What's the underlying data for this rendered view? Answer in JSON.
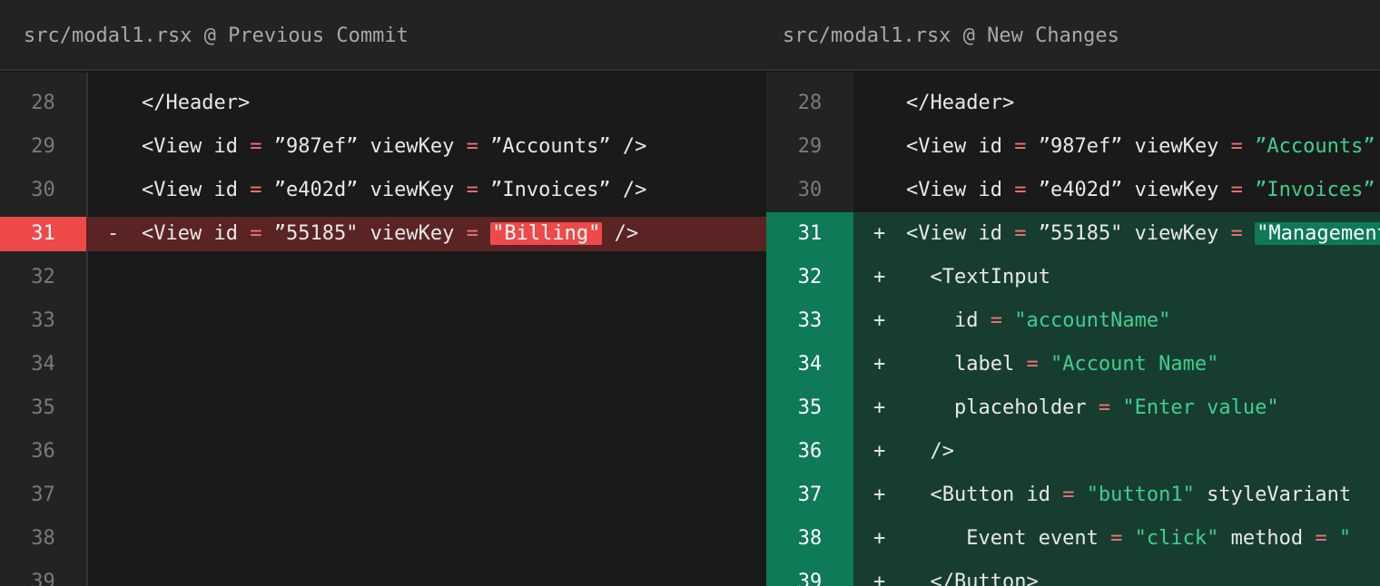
{
  "left": {
    "title": "src/modal1.rsx @ Previous Commit",
    "rows": [
      {
        "n": "28",
        "m": "",
        "kind": "ctx",
        "parts": [
          [
            "t",
            "</Header>"
          ]
        ]
      },
      {
        "n": "29",
        "m": "",
        "kind": "ctx",
        "parts": [
          [
            "t",
            "<View id "
          ],
          [
            "o",
            "="
          ],
          [
            "t",
            " ”987ef” viewKey "
          ],
          [
            "o",
            "="
          ],
          [
            "t",
            " ”Accounts” />"
          ]
        ]
      },
      {
        "n": "30",
        "m": "",
        "kind": "ctx",
        "parts": [
          [
            "t",
            "<View id "
          ],
          [
            "o",
            "="
          ],
          [
            "t",
            " ”e402d” viewKey "
          ],
          [
            "o",
            "="
          ],
          [
            "t",
            " ”Invoices” />"
          ]
        ]
      },
      {
        "n": "31",
        "m": "-",
        "kind": "removed",
        "parts": [
          [
            "t",
            "<View id "
          ],
          [
            "o",
            "="
          ],
          [
            "t",
            " ”55185\" viewKey "
          ],
          [
            "o",
            "="
          ],
          [
            "t",
            " "
          ],
          [
            "hd",
            "\"Billing\""
          ],
          [
            "t",
            " />"
          ]
        ]
      },
      {
        "n": "32",
        "m": "",
        "kind": "empty",
        "parts": []
      },
      {
        "n": "33",
        "m": "",
        "kind": "empty",
        "parts": []
      },
      {
        "n": "34",
        "m": "",
        "kind": "empty",
        "parts": []
      },
      {
        "n": "35",
        "m": "",
        "kind": "empty",
        "parts": []
      },
      {
        "n": "36",
        "m": "",
        "kind": "empty",
        "parts": []
      },
      {
        "n": "37",
        "m": "",
        "kind": "empty",
        "parts": []
      },
      {
        "n": "38",
        "m": "",
        "kind": "empty",
        "parts": []
      },
      {
        "n": "39",
        "m": "",
        "kind": "empty",
        "parts": []
      }
    ]
  },
  "right": {
    "title": "src/modal1.rsx @ New Changes",
    "rows": [
      {
        "n": "28",
        "m": "",
        "kind": "ctx",
        "parts": [
          [
            "t",
            "</Header>"
          ]
        ]
      },
      {
        "n": "29",
        "m": "",
        "kind": "ctx",
        "parts": [
          [
            "t",
            "<View id "
          ],
          [
            "o",
            "="
          ],
          [
            "t",
            " ”987ef” viewKey "
          ],
          [
            "o",
            "="
          ],
          [
            "t",
            " "
          ],
          [
            "s",
            "”Accounts” />"
          ]
        ]
      },
      {
        "n": "30",
        "m": "",
        "kind": "ctx",
        "parts": [
          [
            "t",
            "<View id "
          ],
          [
            "o",
            "="
          ],
          [
            "t",
            " ”e402d” viewKey "
          ],
          [
            "o",
            "="
          ],
          [
            "t",
            " "
          ],
          [
            "s",
            "”Invoices” />"
          ]
        ]
      },
      {
        "n": "31",
        "m": "+",
        "kind": "added",
        "parts": [
          [
            "t",
            "<View id "
          ],
          [
            "o",
            "="
          ],
          [
            "t",
            " ”55185\" viewKey "
          ],
          [
            "o",
            "="
          ],
          [
            "t",
            " "
          ],
          [
            "ha",
            "\"Management\""
          ]
        ]
      },
      {
        "n": "32",
        "m": "+",
        "kind": "added",
        "parts": [
          [
            "t",
            "  <TextInput"
          ]
        ]
      },
      {
        "n": "33",
        "m": "+",
        "kind": "added",
        "parts": [
          [
            "t",
            "    id "
          ],
          [
            "o",
            "="
          ],
          [
            "t",
            " "
          ],
          [
            "s",
            "\"accountName\""
          ]
        ]
      },
      {
        "n": "34",
        "m": "+",
        "kind": "added",
        "parts": [
          [
            "t",
            "    label "
          ],
          [
            "o",
            "="
          ],
          [
            "t",
            " "
          ],
          [
            "s",
            "\"Account Name\""
          ]
        ]
      },
      {
        "n": "35",
        "m": "+",
        "kind": "added",
        "parts": [
          [
            "t",
            "    placeholder "
          ],
          [
            "o",
            "="
          ],
          [
            "t",
            " "
          ],
          [
            "s",
            "\"Enter value\""
          ]
        ]
      },
      {
        "n": "36",
        "m": "+",
        "kind": "added",
        "parts": [
          [
            "t",
            "  />"
          ]
        ]
      },
      {
        "n": "37",
        "m": "+",
        "kind": "added",
        "parts": [
          [
            "t",
            "  <Button id "
          ],
          [
            "o",
            "="
          ],
          [
            "t",
            " "
          ],
          [
            "s",
            "\"button1\""
          ],
          [
            "t",
            " styleVariant"
          ]
        ]
      },
      {
        "n": "38",
        "m": "+",
        "kind": "added",
        "parts": [
          [
            "t",
            "     Event event "
          ],
          [
            "o",
            "="
          ],
          [
            "t",
            " "
          ],
          [
            "s",
            "\"click\""
          ],
          [
            "t",
            " method "
          ],
          [
            "o",
            "="
          ],
          [
            "t",
            " "
          ],
          [
            "s",
            "\""
          ]
        ]
      },
      {
        "n": "39",
        "m": "+",
        "kind": "added",
        "parts": [
          [
            "t",
            "  </Button>"
          ]
        ]
      }
    ]
  },
  "colors": {
    "removed_gutter": "#ee4a4a",
    "removed_row": "#5a2424",
    "added_gutter": "#0e7a57",
    "added_row": "#173d31",
    "operator": "#f07373",
    "string": "#3ecf8e"
  }
}
